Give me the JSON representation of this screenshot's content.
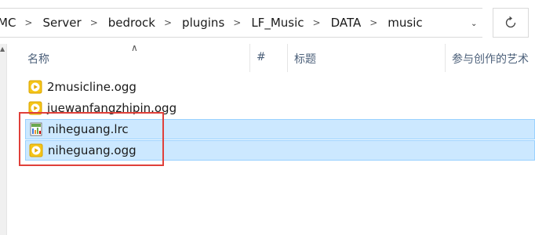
{
  "breadcrumb": {
    "items": [
      "MC",
      "Server",
      "bedrock",
      "plugins",
      "LF_Music",
      "DATA",
      "music"
    ],
    "separator": ">"
  },
  "columns": {
    "name": "名称",
    "number": "#",
    "title": "标题",
    "artist": "参与创作的艺术"
  },
  "files": [
    {
      "name": "2musicline.ogg",
      "icon": "audio-file-icon",
      "selected": false
    },
    {
      "name": "juewanfangzhipin.ogg",
      "icon": "audio-file-icon",
      "selected": false
    },
    {
      "name": "niheguang.lrc",
      "icon": "lrc-file-icon",
      "selected": true
    },
    {
      "name": "niheguang.ogg",
      "icon": "audio-file-icon",
      "selected": true
    }
  ],
  "colors": {
    "selection_bg": "#cce8ff",
    "selection_border": "#99d1ff",
    "annotation_box": "#e0403a",
    "header_text": "#4c607a"
  }
}
